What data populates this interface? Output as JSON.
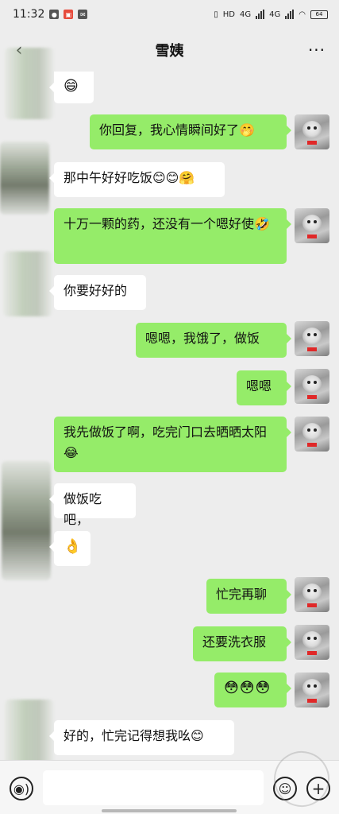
{
  "status_bar": {
    "time": "11:32",
    "network_1": "4G",
    "network_2": "4G",
    "hd": "HD",
    "battery": "64"
  },
  "header": {
    "back_glyph": "‹",
    "title": "雪姨",
    "more_glyph": "···"
  },
  "messages": [
    {
      "from": "other",
      "text": "😄"
    },
    {
      "from": "me",
      "text": "你回复，我心情瞬间好了🤭"
    },
    {
      "from": "other",
      "text": "那中午好好吃饭😊😊🤗"
    },
    {
      "from": "me",
      "text": "十万一颗的药，还没有一个嗯好使🤣"
    },
    {
      "from": "other",
      "text": "你要好好的"
    },
    {
      "from": "me",
      "text": "嗯嗯，我饿了，做饭"
    },
    {
      "from": "me",
      "text": "嗯嗯"
    },
    {
      "from": "me",
      "text": "我先做饭了啊，吃完门口去晒晒太阳😂"
    },
    {
      "from": "other",
      "text": "做饭吃吧，"
    },
    {
      "from": "other",
      "text": "👌"
    },
    {
      "from": "me",
      "text": "忙完再聊"
    },
    {
      "from": "me",
      "text": "还要洗衣服"
    },
    {
      "from": "me",
      "text": "😳😳😳"
    },
    {
      "from": "other",
      "text": "好的，忙完记得想我吆😊"
    }
  ],
  "input_bar": {
    "voice_icon": "voice-icon",
    "emoji_icon": "emoji-icon",
    "plus_icon": "plus-icon",
    "placeholder": ""
  },
  "colors": {
    "background": "#ededed",
    "outgoing_bubble": "#95ec69",
    "incoming_bubble": "#ffffff"
  }
}
